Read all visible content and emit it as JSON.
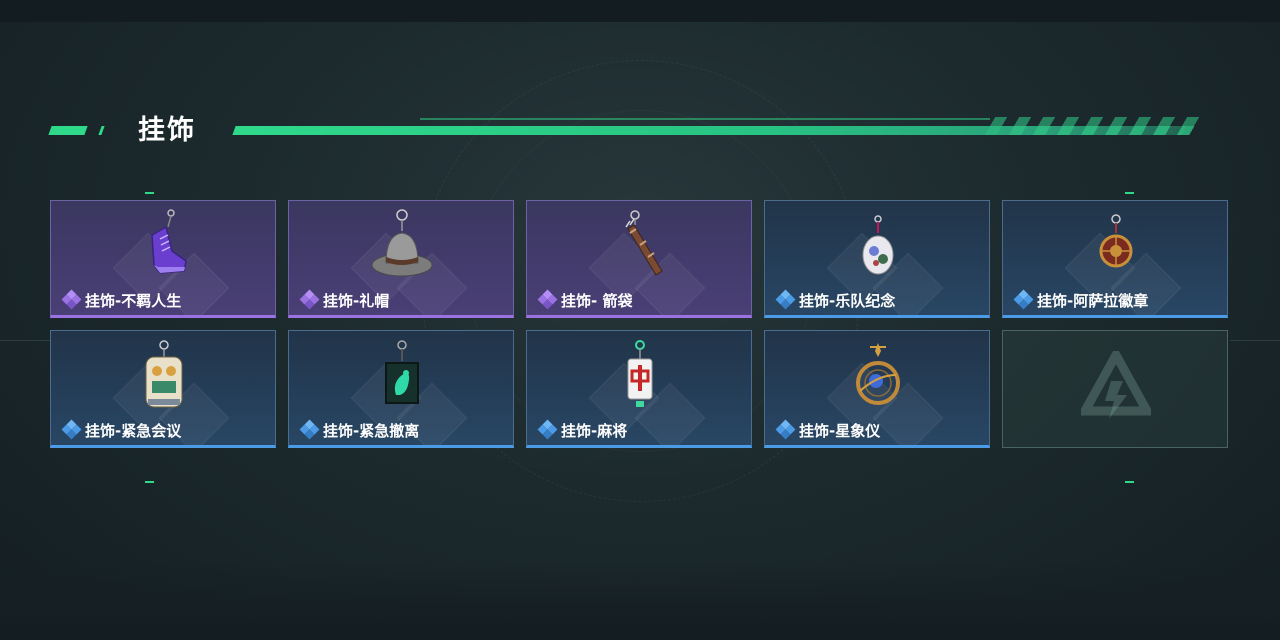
{
  "section": {
    "title": "挂饰"
  },
  "colors": {
    "accent": "#2fd98a",
    "rarity_purple": "#9a72e2",
    "rarity_blue": "#4c9be6"
  },
  "items": [
    {
      "name": "挂饰-不羁人生",
      "rarity": "purple",
      "icon": "sneaker-charm-icon"
    },
    {
      "name": "挂饰-礼帽",
      "rarity": "purple",
      "icon": "fedora-hat-charm-icon"
    },
    {
      "name": "挂饰- 箭袋",
      "rarity": "purple",
      "icon": "quiver-charm-icon"
    },
    {
      "name": "挂饰-乐队纪念",
      "rarity": "blue",
      "icon": "band-badge-charm-icon"
    },
    {
      "name": "挂饰-阿萨拉徽章",
      "rarity": "blue",
      "icon": "emblem-charm-icon"
    },
    {
      "name": "挂饰-紧急会议",
      "rarity": "blue",
      "icon": "emergency-meeting-charm-icon"
    },
    {
      "name": "挂饰-紧急撤离",
      "rarity": "blue",
      "icon": "evacuation-charm-icon"
    },
    {
      "name": "挂饰-麻将",
      "rarity": "blue",
      "icon": "mahjong-tile-charm-icon"
    },
    {
      "name": "挂饰-星象仪",
      "rarity": "blue",
      "icon": "astrolabe-charm-icon"
    },
    {
      "name": "",
      "rarity": "empty",
      "icon": "game-logo-icon"
    }
  ]
}
